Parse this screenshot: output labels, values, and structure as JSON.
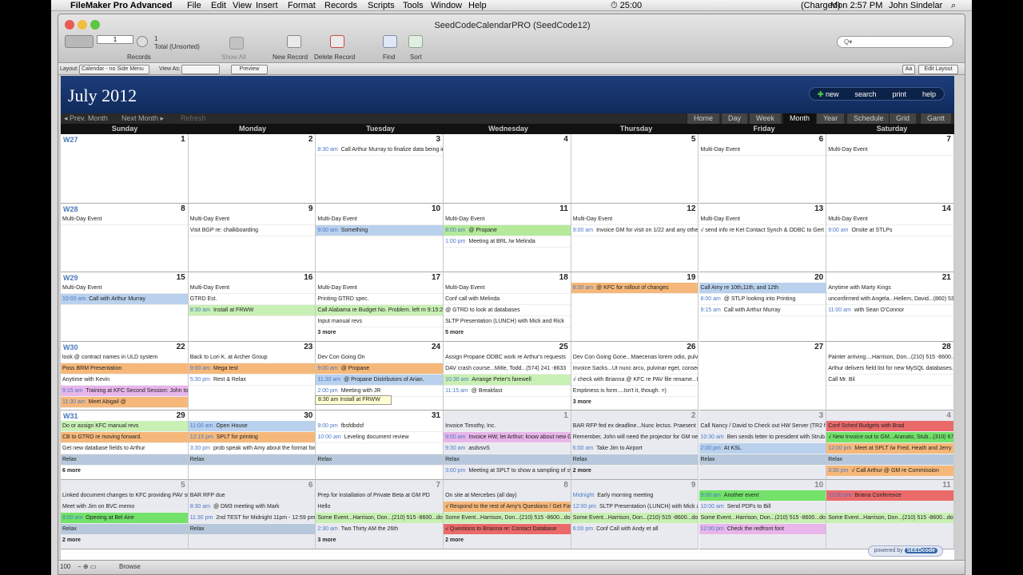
{
  "menubar": {
    "app": "FileMaker Pro Advanced",
    "items": [
      "File",
      "Edit",
      "View",
      "Insert",
      "Format",
      "Records",
      "Scripts",
      "Tools",
      "Window",
      "Help"
    ],
    "time_elapsed": "25:00",
    "battery": "(Charged)",
    "clock": "Mon 2:57 PM",
    "user": "John Sindelar"
  },
  "window": {
    "title": "SeedCodeCalendarPRO (SeedCode12)"
  },
  "toolbar": {
    "record_num": "1",
    "total": "1",
    "total_label": "Total (Unsorted)",
    "records_label": "Records",
    "show_all": "Show All",
    "new_record": "New Record",
    "delete_record": "Delete Record",
    "find": "Find",
    "sort": "Sort",
    "search_placeholder": "Q▾"
  },
  "layoutbar": {
    "layout_label": "Layout:",
    "layout_value": "Calendar - no Side Menu",
    "view_as": "View As:",
    "preview": "Preview",
    "aa": "Aa",
    "edit_layout": "Edit Layout"
  },
  "header": {
    "month": "July 2012",
    "buttons": [
      "new",
      "search",
      "print",
      "help"
    ]
  },
  "nav": {
    "prev": "◂  Prev. Month",
    "next": "Next Month  ▸",
    "refresh": "Refresh",
    "views": [
      "Home",
      "Day",
      "Week",
      "Month",
      "Year",
      "Schedule",
      "Grid",
      "Gantt"
    ],
    "active_view": "Month"
  },
  "days": [
    "Sunday",
    "Monday",
    "Tuesday",
    "Wednesday",
    "Thursday",
    "Friday",
    "Saturday"
  ],
  "weeks": [
    {
      "label": "W27",
      "cells": [
        {
          "day": "1",
          "events": []
        },
        {
          "day": "2",
          "events": []
        },
        {
          "day": "3",
          "events": [
            {
              "time": "8:30 am",
              "text": "Call Arthur Murray to finalize data being imported for the HW Beta"
            }
          ]
        },
        {
          "day": "4",
          "events": []
        },
        {
          "day": "5",
          "events": []
        },
        {
          "day": "6",
          "events": [
            {
              "text": "Multi-Day Event"
            }
          ]
        },
        {
          "day": "7",
          "events": [
            {
              "text": "Multi-Day Event"
            }
          ]
        }
      ]
    },
    {
      "label": "W28",
      "cells": [
        {
          "day": "8",
          "events": [
            {
              "text": "Multi-Day Event"
            }
          ]
        },
        {
          "day": "9",
          "events": [
            {
              "text": "Multi-Day Event"
            },
            {
              "text": "Visit BGP re: chalkboarding"
            }
          ]
        },
        {
          "day": "10",
          "events": [
            {
              "text": "Multi-Day Event"
            },
            {
              "time": "9:00 am",
              "text": "Something",
              "c": "blue"
            }
          ]
        },
        {
          "day": "11",
          "events": [
            {
              "text": "Multi-Day Event"
            },
            {
              "time": "8:00 am",
              "text": "@ Propane",
              "c": "green"
            },
            {
              "time": "1:00 pm",
              "text": "Meeting at BRL /w Melinda"
            }
          ]
        },
        {
          "day": "12",
          "events": [
            {
              "text": "Multi-Day Event"
            },
            {
              "time": "9:00 am",
              "text": "Invoice GM for visit on 1/22 and any other enhancements"
            }
          ]
        },
        {
          "day": "13",
          "events": [
            {
              "text": "Multi-Day Event"
            },
            {
              "text": "√ send info re Ket Contact Synch & ODBC to Gert"
            }
          ]
        },
        {
          "day": "14",
          "events": [
            {
              "text": "Multi-Day Event"
            },
            {
              "time": "9:00 am",
              "text": "Onsite at STLPs"
            }
          ]
        }
      ]
    },
    {
      "label": "W29",
      "cells": [
        {
          "day": "15",
          "events": [
            {
              "text": "Multi-Day Event"
            },
            {
              "time": "10:00 am",
              "text": "Call with Arthur Murray",
              "c": "blue"
            }
          ]
        },
        {
          "day": "16",
          "events": [
            {
              "text": "Multi-Day Event"
            },
            {
              "text": "GTRD Est."
            },
            {
              "time": "8:30 am",
              "text": "Install at FRWW",
              "c": "lgreen"
            }
          ]
        },
        {
          "day": "17",
          "events": [
            {
              "text": "Multi-Day Event"
            },
            {
              "text": "Printing GTRD spec."
            },
            {
              "text": "Call Alabama re Budget No. Problem. left m 9:15:21 AM - Hellem, David - (860) 537",
              "c": "lgreen"
            },
            {
              "text": "Input manual revs"
            }
          ],
          "more": "3 more"
        },
        {
          "day": "18",
          "events": [
            {
              "text": "Multi-Day Event"
            },
            {
              "text": "Conf call with Melinda"
            },
            {
              "text": "@ GTRD to look at databases"
            },
            {
              "text": "SLTP Presentation (LUNCH) with Mick and Rick"
            }
          ],
          "more": "5 more"
        },
        {
          "day": "19",
          "events": [
            {
              "time": "8:00 am",
              "text": "@ KFC for rollout of changes",
              "c": "orange"
            }
          ]
        },
        {
          "day": "20",
          "events": [
            {
              "text": "Call Amy re  10th,11th, and 12th",
              "c": "blue"
            },
            {
              "time": "8:00 am",
              "text": "@ STLP looking into Printing"
            },
            {
              "time": "9:15 am",
              "text": "Call with Arthur Murray"
            }
          ]
        },
        {
          "day": "21",
          "events": [
            {
              "text": "Anytime with Marty Kings"
            },
            {
              "text": "unconfirmed with Angela...Hellem, David...(860) 537-1729...dave@endgoicco.com"
            },
            {
              "time": "11:00 am",
              "text": "with Sean O'Connor"
            }
          ]
        }
      ]
    },
    {
      "label": "W30",
      "cells": [
        {
          "day": "22",
          "events": [
            {
              "text": "look @ contract names in ULD system"
            },
            {
              "text": "Poss BRM Presentation",
              "c": "orange"
            },
            {
              "text": "Anytime with Kevin"
            },
            {
              "time": "9:15 am",
              "text": "Training at KFC Second Session: John to pickup projector",
              "c": "pink"
            },
            {
              "time": "11:30 am",
              "text": "Meet Abigail @",
              "c": "orange"
            }
          ]
        },
        {
          "day": "23",
          "events": [
            {
              "text": "Back to Lori K. at Archer Group"
            },
            {
              "time": "9:00 am",
              "text": "Mega test",
              "c": "orange"
            },
            {
              "time": "5:30 pm",
              "text": "Rest & Relax"
            }
          ]
        },
        {
          "day": "24",
          "events": [
            {
              "text": "Dev Con Going On"
            },
            {
              "time": "9:00 am",
              "text": "@ Propane",
              "c": "orange"
            },
            {
              "time": "11:30 am",
              "text": "@ Propane Distributors of Arian.",
              "c": "blue"
            },
            {
              "time": "2:00 pm",
              "text": "Meeting with JR"
            }
          ],
          "more": "2 more"
        },
        {
          "day": "25",
          "events": [
            {
              "text": "Assign Propane ODBC work re Arthur's requests"
            },
            {
              "text": "DAV crash course...Mitle, Todd...(574) 241 -8633"
            },
            {
              "time": "10:30 am",
              "text": "Arrange Peter's farewell",
              "c": "lgreen"
            },
            {
              "time": "11:15 am",
              "text": "@ Breakfast"
            }
          ]
        },
        {
          "day": "26",
          "events": [
            {
              "text": "Dev Con Going Gone...Maecenas lorem odio, pulvinar quis, euismod non, egestas"
            },
            {
              "text": "Invoice Sacks...Ut nunc arcu, pulvinar eget, consectetuer ac, nonummy eget, eros."
            },
            {
              "text": "√ check with Brianna @ KFC re PAV file rename...Praesent dapibus fermentum dui."
            },
            {
              "text": "Emptiness is form....Isn't it, though. =)"
            }
          ],
          "more": "3 more"
        },
        {
          "day": "27",
          "events": []
        },
        {
          "day": "28",
          "events": [
            {
              "text": "Painter arriving....Harrison, Don...(210) 515 -8600...don@alphacomp.com"
            },
            {
              "text": "Arthur delivers field list for new MySQL databases...Nam risus felis, vulputate id, tempus"
            },
            {
              "text": "Call Mr. Bil"
            }
          ]
        }
      ]
    },
    {
      "label": "W31",
      "cells": [
        {
          "day": "29",
          "events": [
            {
              "text": "Do or assign KFC manual revs",
              "c": "lgreen"
            },
            {
              "text": "CB to GTRD re moving forward.",
              "c": "orange"
            },
            {
              "text": "Get new database fields to Arthur"
            },
            {
              "text": "Relax",
              "c": "relax"
            }
          ],
          "more": "6 more"
        },
        {
          "day": "30",
          "events": [
            {
              "time": "11:00 am",
              "text": "Open House",
              "c": "blue"
            },
            {
              "time": "12:15 pm",
              "text": "SPLT for printing",
              "c": "orange"
            },
            {
              "time": "3:30 pm",
              "text": "prob speak with Amy about the format for export files at Voslav"
            },
            {
              "text": "Relax",
              "c": "relax"
            }
          ]
        },
        {
          "day": "31",
          "events": [
            {
              "time": "9:00 pm",
              "text": "fbsfdbdsf"
            },
            {
              "time": "10:00 am",
              "text": "Leveling document review"
            },
            {
              "text": ""
            },
            {
              "text": "Relax",
              "c": "relax"
            }
          ]
        },
        {
          "day": "1",
          "oth": true,
          "events": [
            {
              "text": "Invoice Timothy, Inc."
            },
            {
              "time": "9:00 am",
              "text": "Invoice HW, let Arthur; know about new Gantt charts; Pronto",
              "c": "pink"
            },
            {
              "time": "9:30 am",
              "text": "asdvsvS"
            },
            {
              "text": "Relax",
              "c": "relax"
            },
            {
              "time": "3:00 pm",
              "text": "Meeting at SPLT to show a sampling of systems for idea generation"
            }
          ]
        },
        {
          "day": "2",
          "oth": true,
          "events": [
            {
              "text": "BAR RFP fed ex deadline...Nunc lectus. Praesent dapibus fermentum dui. Morbi"
            },
            {
              "text": "Remember, John will need the projector for GM next Thursday...Hemley"
            },
            {
              "time": "6:00 am",
              "text": "Take Jim to Airport"
            },
            {
              "text": "Relax",
              "c": "relax"
            }
          ],
          "more": "2 more"
        },
        {
          "day": "3",
          "oth": true,
          "events": [
            {
              "text": "Call Nancy / David to Check out HW Server (TR2 for stats first)...ask David about"
            },
            {
              "time": "10:30 am",
              "text": "Ben sends letter to president with Strub...(310) 677-5515...sarang@Alvstrong"
            },
            {
              "time": "2:00 pm",
              "text": "At KSL",
              "c": "blue"
            },
            {
              "text": "Relax",
              "c": "relax"
            }
          ]
        },
        {
          "day": "4",
          "oth": true,
          "events": [
            {
              "text": "Conf Sched Budgets with Brad",
              "c": "red"
            },
            {
              "text": "√ New Invoice out to GM...Aranato, Stub...(310) 677-5515...sarang@Alvstrong",
              "c": "bgreen"
            },
            {
              "time": "12:00 pm",
              "text": "Meet at SPLT /w Fred, Heath and Jerry",
              "c": "orange"
            },
            {
              "text": "Relax",
              "c": "relax"
            },
            {
              "time": "3:30 pm",
              "text": "√ Call Arthur @ GM re Commission",
              "c": "orange"
            }
          ]
        }
      ]
    },
    {
      "label": "",
      "cells": [
        {
          "day": "5",
          "oth": true,
          "events": [
            {
              "text": "Linked document changes to KFC providing PAV stays up"
            },
            {
              "text": "Meet with Jim on BVC memo"
            },
            {
              "time": "8:00 am",
              "text": "Opening at Bel Aire",
              "c": "bgreen"
            },
            {
              "text": "Relax",
              "c": "relax"
            }
          ],
          "more": "2 more"
        },
        {
          "day": "6",
          "oth": true,
          "events": [
            {
              "text": "BAR RFP due"
            },
            {
              "time": "8:30 am",
              "text": "@ DM3 meeting with Mark"
            },
            {
              "time": "11:30 pm",
              "text": "2nd TEST for Midnight 11pm - 12:59 pm"
            },
            {
              "text": "Relax",
              "c": "relax"
            }
          ]
        },
        {
          "day": "7",
          "oth": true,
          "events": [
            {
              "text": "Prep for installation of Private Beta at GM PD"
            },
            {
              "text": "Hello"
            },
            {
              "text": "Some Event...Harrison, Don...(210) 515 -8600...don@alphacomp.com",
              "c": "lgreen"
            },
            {
              "time": "2:30 am",
              "text": "Two Thirty AM the 26th"
            }
          ],
          "more": "3 more"
        },
        {
          "day": "8",
          "oth": true,
          "events": [
            {
              "text": "On site at Mercebes (all day)"
            },
            {
              "text": "√ Respond to the rest of Amy's Questions / Get Fav",
              "c": "orange"
            },
            {
              "text": "Some Event...Harrison, Don...(210) 515 -8600...don@alphacomp.com",
              "c": "lgreen"
            },
            {
              "text": "√ Questions to Brianna re: Contact Database",
              "c": "red"
            }
          ],
          "more": "2 more"
        },
        {
          "day": "9",
          "oth": true,
          "events": [
            {
              "time": "Midnight",
              "text": "Early morning meeting"
            },
            {
              "time": "12:00 pm",
              "text": "SLTP Presentation (LUNCH) with Mick and Rick"
            },
            {
              "text": "Some Event...Harrison, Don...(210) 515 -8600...don@alphacomp.com",
              "c": "lgreen"
            },
            {
              "time": "6:00 pm",
              "text": "Conf Call with Andy et all"
            }
          ]
        },
        {
          "day": "10",
          "oth": true,
          "events": [
            {
              "time": "9:00 am",
              "text": "Another event",
              "c": "bgreen"
            },
            {
              "time": "10:00 am",
              "text": "Send PDFs to Bill"
            },
            {
              "text": "Some Event...Harrison, Don...(210) 515 -8600...don@alphacomp.com",
              "c": "lgreen"
            },
            {
              "time": "12:00 pm",
              "text": "Check the redfront font",
              "c": "pink"
            }
          ]
        },
        {
          "day": "11",
          "oth": true,
          "events": [
            {
              "time": "12:00 pm",
              "text": "Briana Conference",
              "c": "red"
            },
            {
              "text": ""
            },
            {
              "text": "Some Event...Harrison, Don...(210) 515 -8600...don@alphacomp.com",
              "c": "lgreen"
            }
          ]
        }
      ]
    }
  ],
  "tooltip": "8:30 am   Install at FRWW",
  "powered": {
    "text": "powered by",
    "brand": "SEEDcode"
  },
  "status": {
    "zoom": "100",
    "mode": "Browse"
  }
}
